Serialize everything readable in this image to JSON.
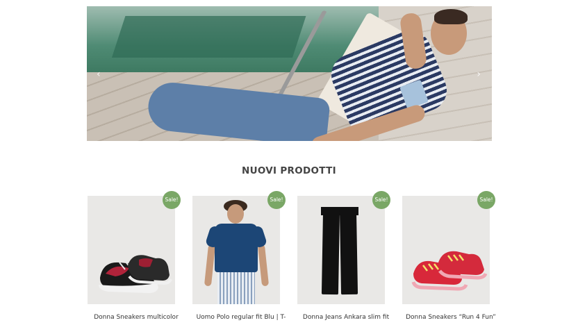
{
  "hero": {
    "prev_arrow": "‹",
    "next_arrow": "›"
  },
  "section": {
    "title": "NUOVI PRODOTTI"
  },
  "products": [
    {
      "name": "Donna Sneakers multicolor",
      "badge": "Sale!",
      "image": "black-red-sneakers"
    },
    {
      "name": "Uomo Polo regular fit Blu | T-",
      "badge": "Sale!",
      "image": "blue-polo-model"
    },
    {
      "name": "Donna Jeans Ankara slim fit",
      "badge": "Sale!",
      "image": "black-jeans"
    },
    {
      "name": "Donna Sneakers “Run 4 Fun”",
      "badge": "Sale!",
      "image": "red-sneakers"
    }
  ],
  "colors": {
    "sale_badge": "#7aa766",
    "product_bg": "#e9e8e6"
  }
}
